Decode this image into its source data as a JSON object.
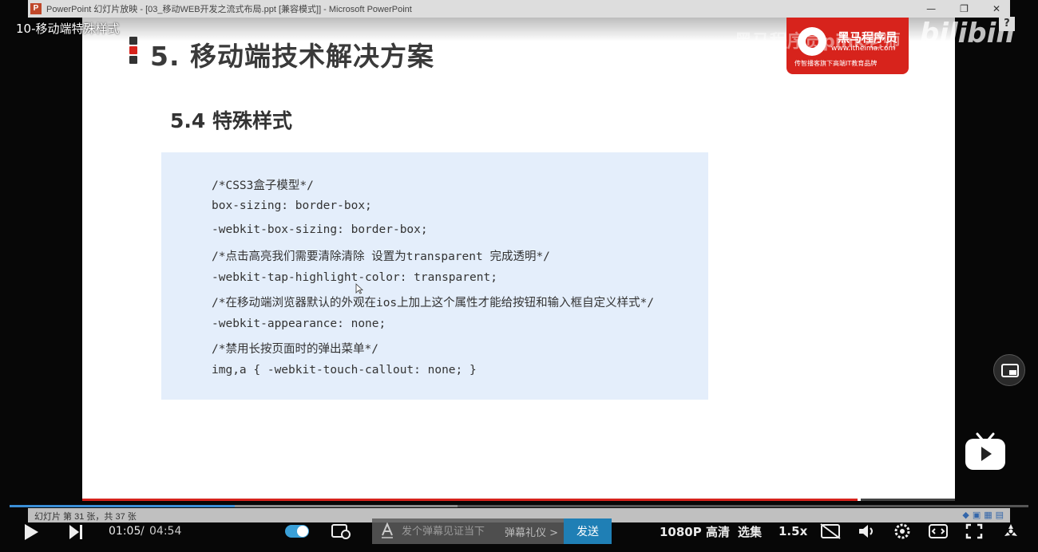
{
  "window": {
    "title": "PowerPoint 幻灯片放映 - [03_移动WEB开发之流式布局.ppt [兼容模式]] - Microsoft PowerPoint",
    "app_icon_letter": "P",
    "controls": [
      "—",
      "❐",
      "✕"
    ]
  },
  "video": {
    "title": "10-移动端特殊样式"
  },
  "watermark": {
    "text": "黑马程序员pink老师",
    "platform_logo": "bilibili",
    "help_label": "?"
  },
  "slide": {
    "heading": "5. 移动端技术解决方案",
    "subheading": "5.4 特殊样式",
    "logo": {
      "name": "黑马程序员",
      "url": "www.itheima.com",
      "tagline": "传智播客旗下高端IT教育品牌"
    },
    "bullet_colors": [
      "#333333",
      "#d7231c",
      "#333333"
    ],
    "code_lines": [
      "/*CSS3盒子模型*/",
      "box-sizing: border-box;",
      "-webkit-box-sizing: border-box;",
      "/*点击高亮我们需要清除清除  设置为transparent 完成透明*/",
      "-webkit-tap-highlight-color: transparent;",
      "/*在移动端浏览器默认的外观在ios上加上这个属性才能给按钮和输入框自定义样式*/",
      "-webkit-appearance: none;",
      "/*禁用长按页面时的弹出菜单*/",
      "img,a { -webkit-touch-callout: none; }"
    ]
  },
  "ppt_status": {
    "slide_counter": "幻灯片 第 31 张，共 37 张"
  },
  "player": {
    "time_current": "01:05",
    "time_separator": "/",
    "time_total": "04:54",
    "progress_fraction": 0.221,
    "buffer_fraction": 0.44,
    "danmaku_placeholder": "发个弹幕见证当下",
    "danmaku_etiquette": "弹幕礼仪 >",
    "send_label": "发送",
    "quality_label": "1080P 高清",
    "episodes_label": "选集",
    "speed_label": "1.5x",
    "accent_color": "#1f7fb5"
  }
}
